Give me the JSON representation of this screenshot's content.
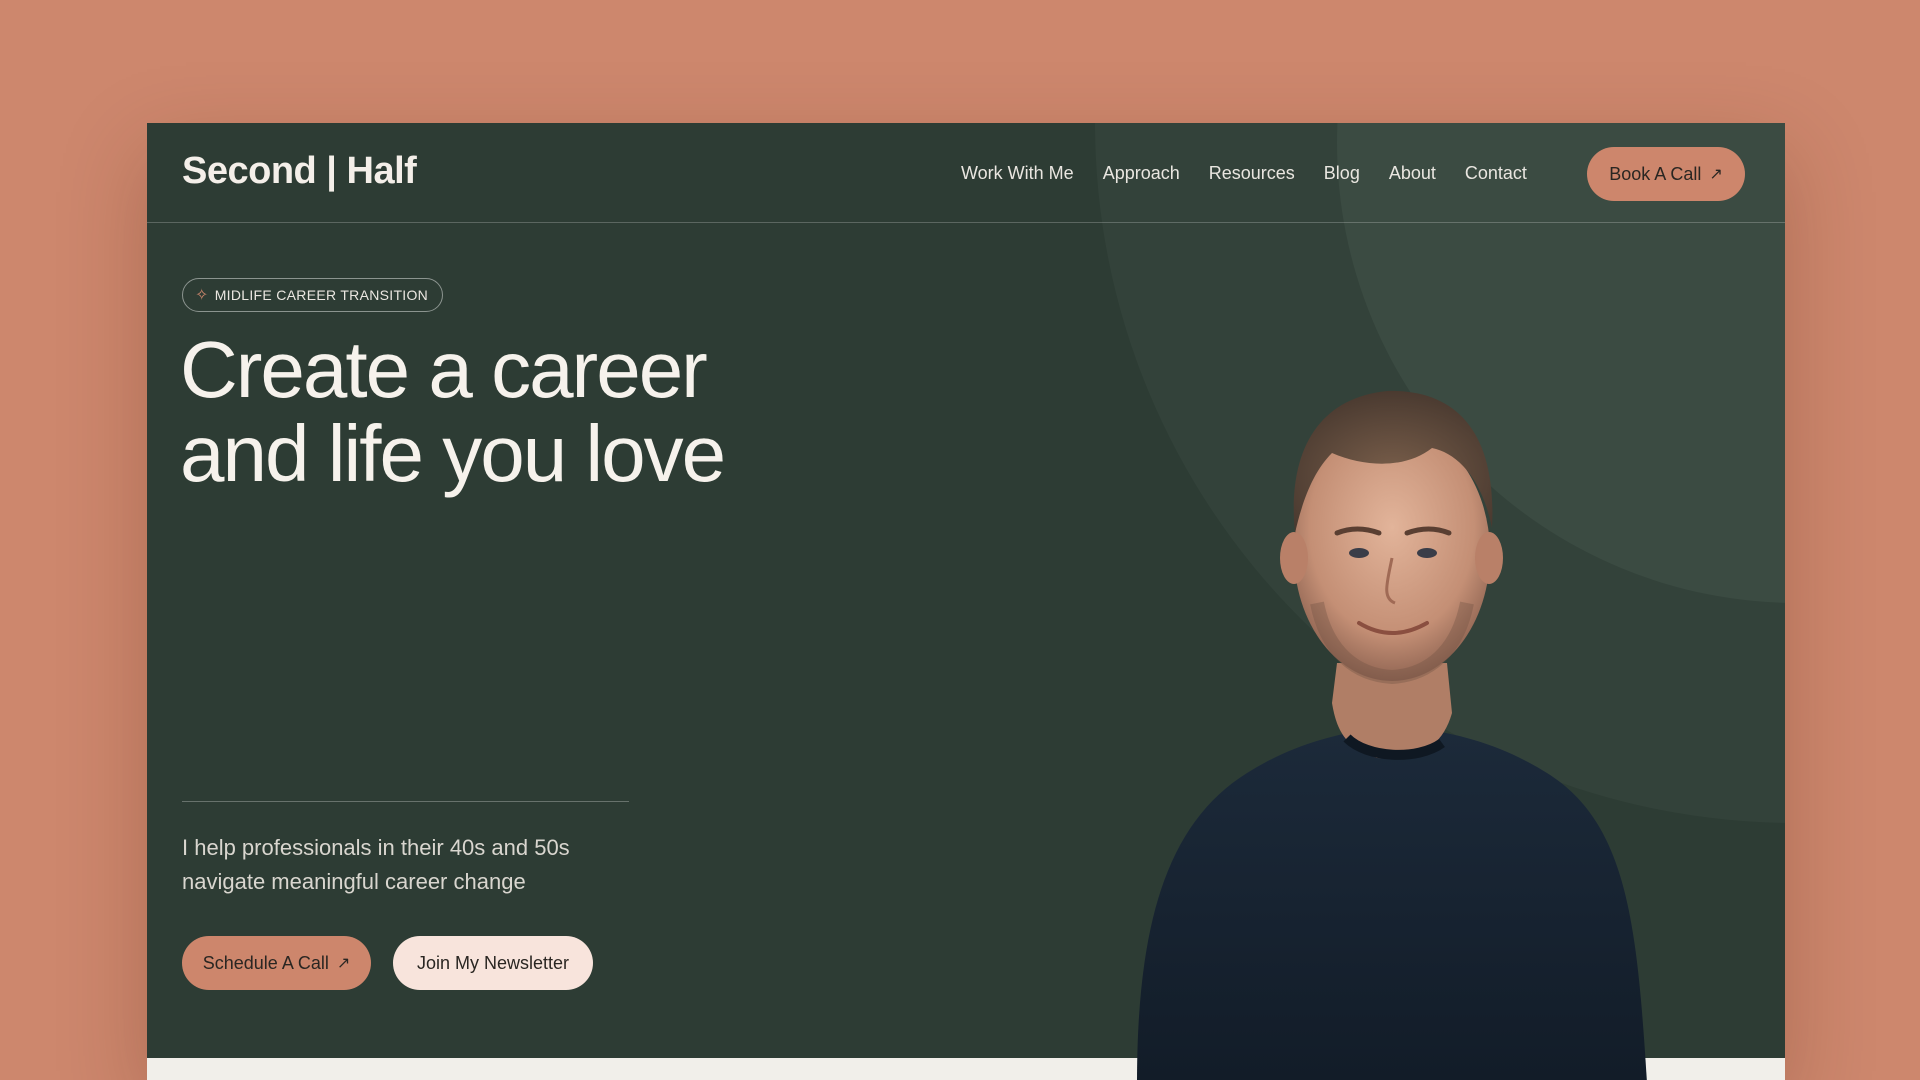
{
  "header": {
    "logo": "Second | Half",
    "nav": [
      "Work With Me",
      "Approach",
      "Resources",
      "Blog",
      "About",
      "Contact"
    ],
    "cta_label": "Book A Call",
    "cta_icon": "arrow-up-right-icon"
  },
  "hero": {
    "badge_icon": "sparkle-icon",
    "badge_text": "MIDLIFE CAREER TRANSITION",
    "headline_line1": "Create a career",
    "headline_line2": "and life you love",
    "subtext": "I help professionals in their 40s and 50s navigate meaningful career change",
    "primary_button": "Schedule A Call",
    "secondary_button": "Join My Newsletter"
  },
  "colors": {
    "page_background": "#cd876d",
    "hero_background": "#2d3c34",
    "accent": "#cd866c",
    "light_button": "#f8e4dc",
    "text_light": "#f6f2ec"
  }
}
